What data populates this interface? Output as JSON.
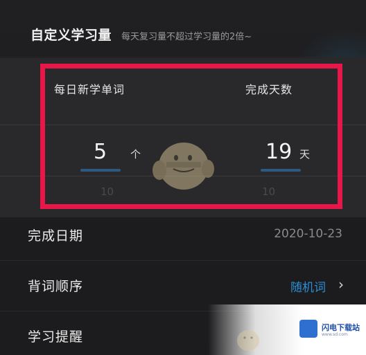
{
  "header": {
    "title": "自定义学习量",
    "hint": "每天复习量不超过学习量的2倍~"
  },
  "picker": {
    "left": {
      "label": "每日新学单词",
      "value": "5",
      "unit": "个",
      "next_value": "10"
    },
    "right": {
      "label": "完成天数",
      "value": "19",
      "unit": "天",
      "next_value": "10"
    }
  },
  "settings": {
    "completion_date": {
      "label": "完成日期",
      "value": "2020-10-23"
    },
    "word_order": {
      "label": "背词顺序",
      "value": "随机词"
    },
    "reminder": {
      "label": "学习提醒"
    }
  },
  "watermark": {
    "name": "闪电下载站",
    "url": "www.sd.com"
  },
  "colors": {
    "highlight": "#e8174a",
    "accent": "#2a8fd6",
    "background": "#1f1f21"
  },
  "icons": {
    "chevron": "chevron-right-icon",
    "mascot": "mascot-icon"
  }
}
